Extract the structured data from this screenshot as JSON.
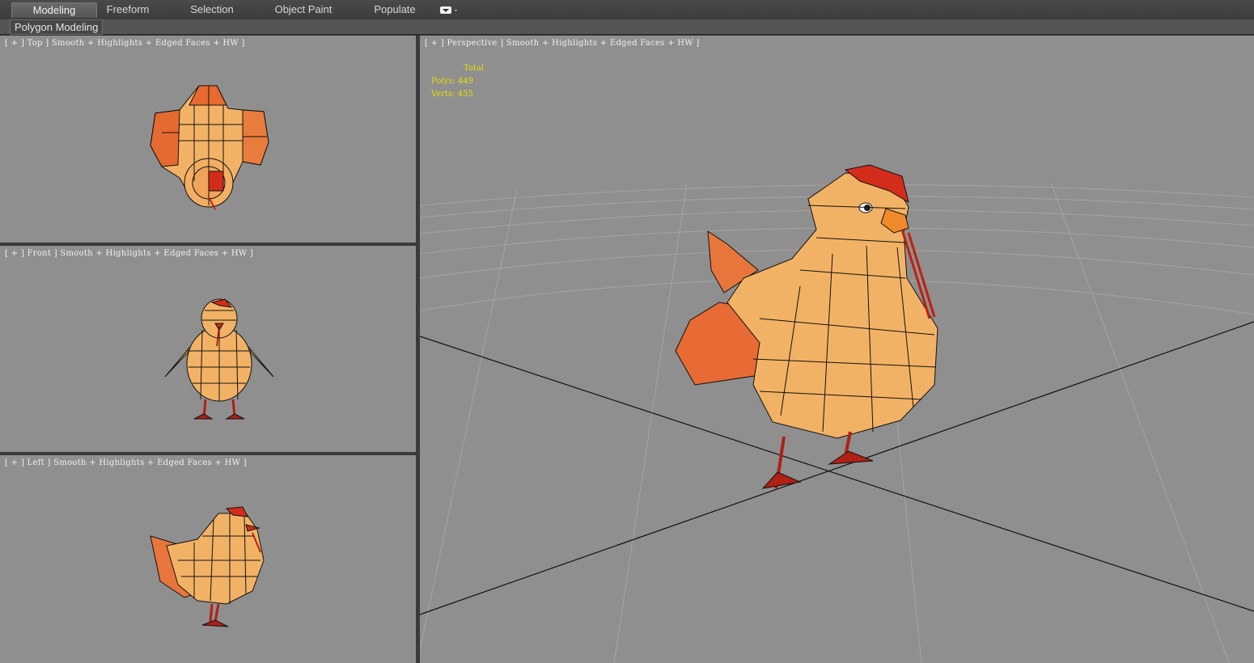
{
  "ribbon": {
    "tabs": [
      {
        "label": "Modeling",
        "active": true
      },
      {
        "label": "Freeform",
        "active": false
      },
      {
        "label": "Selection",
        "active": false
      },
      {
        "label": "Object Paint",
        "active": false
      },
      {
        "label": "Populate",
        "active": false
      }
    ],
    "extra_icon": "dropdown-toggle-icon"
  },
  "subbar": {
    "label": "Polygon Modeling"
  },
  "viewports": {
    "top": {
      "label": "[ + ] Top ] Smooth + Highlights + Edged Faces + HW ]"
    },
    "front": {
      "label": "[ + ] Front ] Smooth + Highlights + Edged Faces + HW ]"
    },
    "left": {
      "label": "[ + ] Left ] Smooth + Highlights + Edged Faces + HW ]"
    },
    "persp": {
      "label": "[ + ] Perspective ] Smooth + Highlights + Edged Faces + HW ]"
    }
  },
  "stats": {
    "total_label": "Total",
    "polys_label": "Polys:",
    "polys_value": "449",
    "verts_label": "Verts:",
    "verts_value": "455"
  },
  "colors": {
    "viewport_bg": "#8f8f8f",
    "stats_text": "#e8e000",
    "body_fill": "#f2b266",
    "comb": "#d42c1a",
    "wire": "#111111"
  }
}
